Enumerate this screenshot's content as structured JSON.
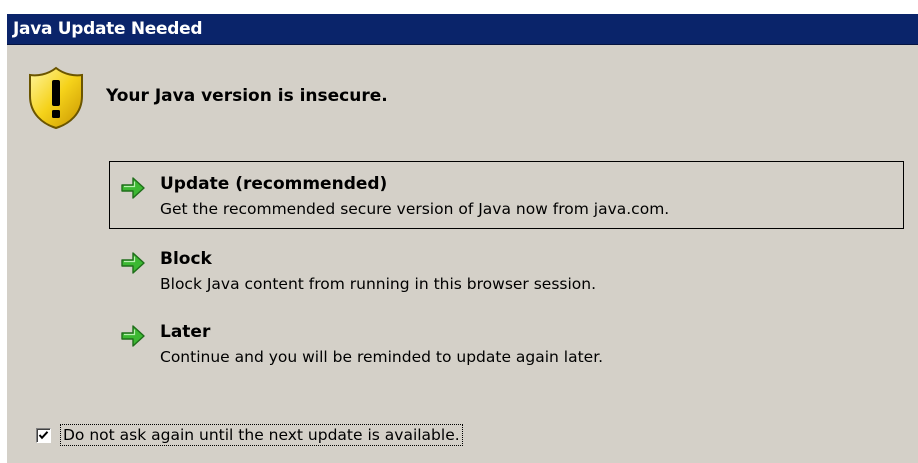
{
  "dialog": {
    "title": "Java Update Needed",
    "icon": "warning-shield-icon",
    "headline": "Your Java version is insecure."
  },
  "options": [
    {
      "title": "Update (recommended)",
      "description": "Get the recommended secure version of Java now from java.com.",
      "icon": "green-arrow-icon",
      "selected": true
    },
    {
      "title": "Block",
      "description": "Block Java content from running in this browser session.",
      "icon": "green-arrow-icon",
      "selected": false
    },
    {
      "title": "Later",
      "description": "Continue and you will be reminded to update again later.",
      "icon": "green-arrow-icon",
      "selected": false
    }
  ],
  "do_not_ask": {
    "label": "Do not ask again until the next update is available.",
    "checked": true
  },
  "colors": {
    "titlebar": "#0a246a",
    "dialog_bg": "#d4d0c8",
    "arrow_green": "#3cb832"
  }
}
